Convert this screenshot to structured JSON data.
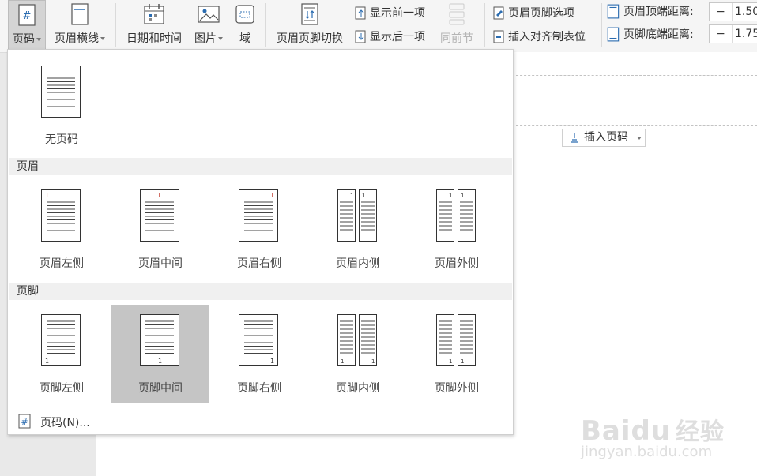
{
  "ribbon": {
    "page_number_label": "页码",
    "header_line_label": "页眉横线",
    "datetime_label": "日期和时间",
    "picture_label": "图片",
    "field_label": "域",
    "switch_label": "页眉页脚切换",
    "show_prev_label": "显示前一项",
    "show_next_label": "显示后一项",
    "same_as_prev_label": "同前节",
    "hf_options_label": "页眉页脚选项",
    "insert_align_tab_label": "插入对齐制表位",
    "header_top_distance_label": "页眉顶端距离:",
    "header_top_distance_value": "1.50",
    "footer_bottom_distance_label": "页脚底端距离:",
    "footer_bottom_distance_value": "1.75",
    "minus_symbol": "−"
  },
  "document": {
    "insert_page_number_label": "插入页码"
  },
  "dropdown": {
    "none_option": "无页码",
    "header_section": "页眉",
    "footer_section": "页脚",
    "page_digit": "1",
    "header_options": [
      "页眉左侧",
      "页眉中间",
      "页眉右侧",
      "页眉内侧",
      "页眉外侧"
    ],
    "footer_options": [
      "页脚左侧",
      "页脚中间",
      "页脚右侧",
      "页脚内侧",
      "页脚外侧"
    ],
    "page_number_dialog": "页码(N)..."
  },
  "watermark": {
    "brand": "Baidu",
    "brand_cn": "经验",
    "url": "jingyan.baidu.com"
  }
}
